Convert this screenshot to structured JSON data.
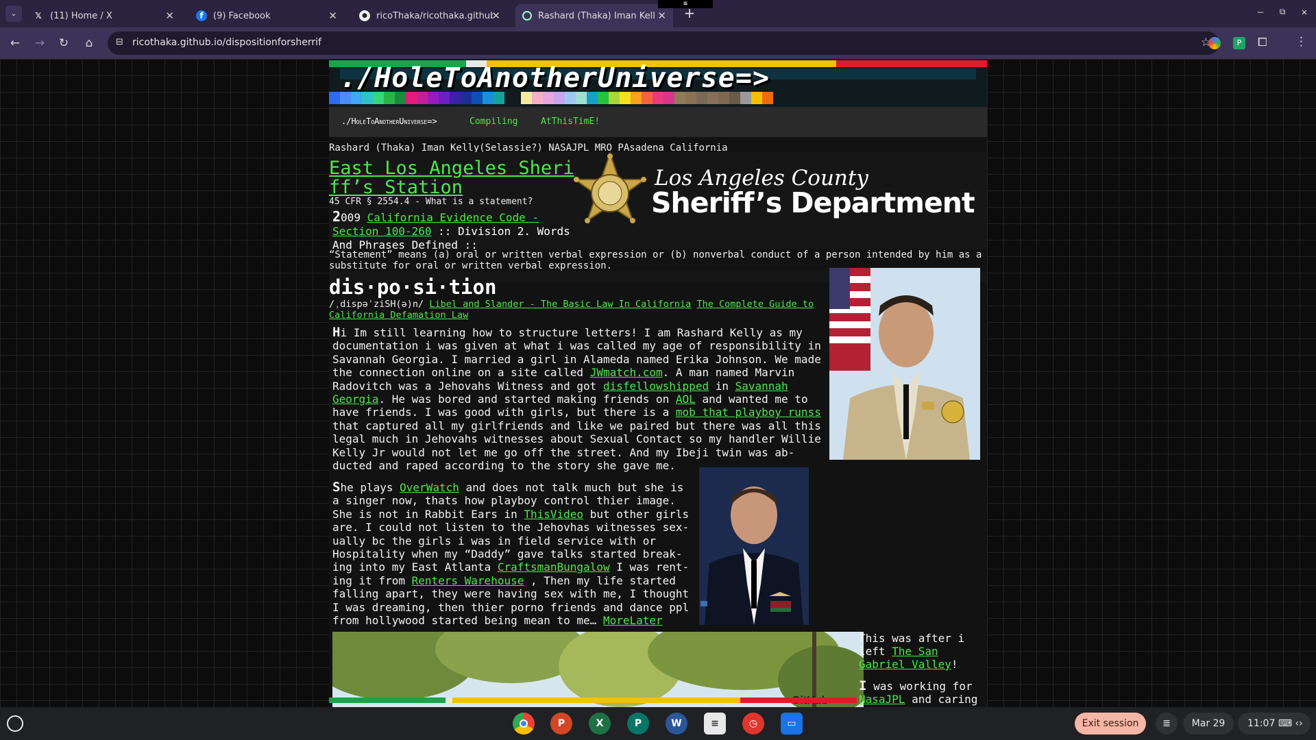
{
  "browser": {
    "tabs": [
      {
        "title": "(11) Home / X",
        "icon": "x-logo-icon"
      },
      {
        "title": "(9) Facebook",
        "icon": "facebook-icon"
      },
      {
        "title": "ricoThaka/ricothaka.github.io",
        "icon": "github-icon"
      },
      {
        "title": "Rashard (Thaka) Iman Kelly(Se",
        "icon": "page-icon",
        "active": true
      }
    ],
    "url": "ricothaka.github.io/dispositionforsherrif"
  },
  "site": {
    "banner_title": "./HoleToAnotherUniverse=>",
    "nav": [
      "./HoleToAnotherUniverse=>",
      "Compiling",
      "AtThisTimE!"
    ],
    "subtitle": "Rashard (Thaka) Iman Kelly(Selassie?) NASAJPL MRO PAsadena California",
    "station_title": "East Los Angeles Sheriff’s Station",
    "cfr": "45 CFR § 2554.4 - What is a statement?",
    "evidence": {
      "year_first": "2",
      "year_rest": "009 ",
      "link": "California Evidence Code - Section 100-260",
      "rest": " :: Division 2. Words And Phrases Defined ::"
    },
    "lasd": {
      "line1": "Los Angeles County",
      "line2": "Sheriff’s Department"
    },
    "statement": "“Statement” means (a) oral or written verbal expression or (b) nonverbal conduct of a person intended by him as a substitute for oral or written verbal expression.",
    "disposition_word": "dis·po·si·tion",
    "pronunciation": "/ˌdispəˈziSH(ə)n/",
    "link_libel": "Libel and Slander - The Basic Law In California",
    "link_defamation": "The Complete Guide to California Defamation Law",
    "para1": {
      "drop": "H",
      "t1": "i Im still learning how to structure letters! I am Rashard Kelly as my documentation i was given at what i was called my age of responsibility in Savannah Georgia. I married a girl in Alameda named Erika Johnson. We made the connection online on a site called ",
      "l1": "JWmatch.com",
      "t2": ". A man named Marvin Radovitch was a Jehovahs Witness and got ",
      "l2": "disfellowshipped",
      "t3": " in ",
      "l3": "Savannah Georgia",
      "t4": ". He was bored and started making friends on ",
      "l4": "AOL",
      "t5": " and wanted me to have friends. I was good with girls, but there is a ",
      "l5": "mob that playboy runss",
      "t6": " that captured all my girlfriends and like we paired but there was all this legal much in Jehovahs witnesses about Sexual Contact so my handler Willie Kelly Jr would not let me go off the street. And my Ibeji twin was ab-ducted and raped according to the story she gave me."
    },
    "para2": {
      "drop": "S",
      "t1": "he plays ",
      "l1": "OverWatch",
      "t2": " and does not talk much but she is a singer now, thats how playboy control thier image. She is not in Rabbit Ears in ",
      "l2": "ThisVideo",
      "t3": " but other girls are. I could not listen to the Jehovhas witnesses sex-ually bc the girls i was in field service with or Hospitality when my “Daddy” gave talks started break-ing into my East Atlanta ",
      "l3": "CraftsmanBungalow",
      "t4": " I was rent-ing it from ",
      "l4": "Renters Warehouse",
      "t5": " , Then my life started falling apart, they were having sex with me, I thought I was dreaming, then thier porno friends and dance ppl from hollywood started being mean to me… ",
      "l5": "MoreLater"
    },
    "side1": {
      "t1": "This was after i left ",
      "l1": "The San Gabriel Valley",
      "t2": "!"
    },
    "side2": {
      "drop": "I",
      "t1": " was working for ",
      "l1": "NasaJPL",
      "t2": " and caring"
    },
    "photo_stamp": "GitHub"
  },
  "taskbar": {
    "exit_session": "Exit session",
    "date": "Mar 29",
    "time": "11:07",
    "apps": [
      "chrome-icon",
      "powerpoint-icon",
      "excel-icon",
      "publisher-icon",
      "word-icon",
      "docs-icon",
      "timer-icon",
      "files-icon"
    ]
  },
  "colors": {
    "accent_green": "#4ee84e",
    "tab_bar": "#2b233f",
    "toolbar": "#3c3358"
  }
}
